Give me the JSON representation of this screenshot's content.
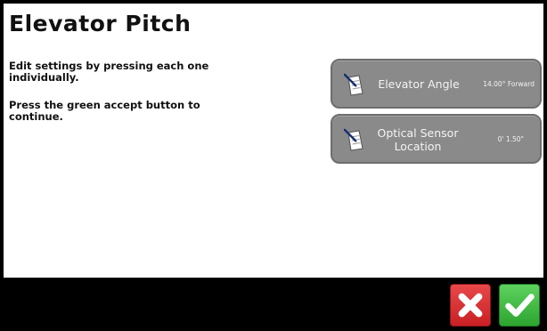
{
  "header": {
    "title": "Elevator Pitch"
  },
  "instructions": {
    "line1": "Edit settings by pressing each one individually.",
    "line2": "Press the green accept button to continue."
  },
  "settings": [
    {
      "label": "Elevator Angle",
      "value": "14.00° Forward",
      "icon": "edit-document-icon"
    },
    {
      "label": "Optical Sensor Location",
      "value": "0' 1.50\"",
      "icon": "edit-document-icon"
    }
  ],
  "footer": {
    "cancel_icon": "x-icon",
    "accept_icon": "checkmark-icon",
    "colors": {
      "cancel": "#d63033",
      "accept": "#3fbf42",
      "bar": "#000000"
    }
  }
}
